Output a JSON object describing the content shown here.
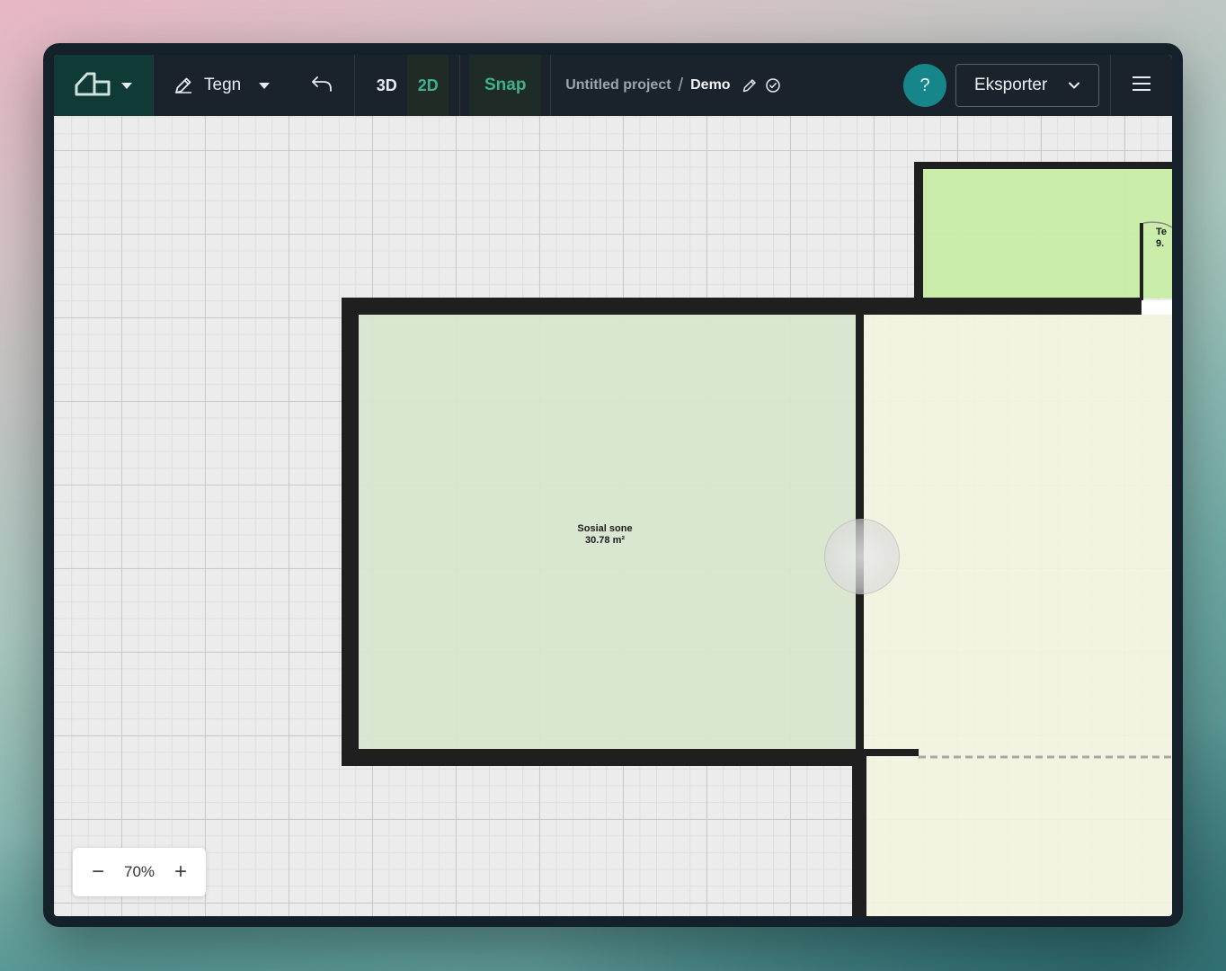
{
  "toolbar": {
    "logo_icon": "house-roof-icon",
    "draw_label": "Tegn",
    "view_3d": "3D",
    "view_2d": "2D",
    "snap_label": "Snap",
    "project_name": "Untitled project",
    "separator": "/",
    "workspace": "Demo",
    "help_label": "?",
    "export_label": "Eksporter"
  },
  "rooms": [
    {
      "name": "Sosial sone",
      "area": "30.78 m²"
    },
    {
      "name": "Te",
      "area": "9."
    }
  ],
  "zoom": {
    "value": "70%",
    "minus": "−",
    "plus": "+"
  },
  "colors": {
    "toolbar_bg": "#1a232c",
    "accent": "#3fb08f",
    "help_bg": "#17868a",
    "room_social": "#d9e7cf",
    "room_top": "#c8eda5",
    "room_right": "#f3f3df",
    "wall": "#1f1f1f"
  }
}
